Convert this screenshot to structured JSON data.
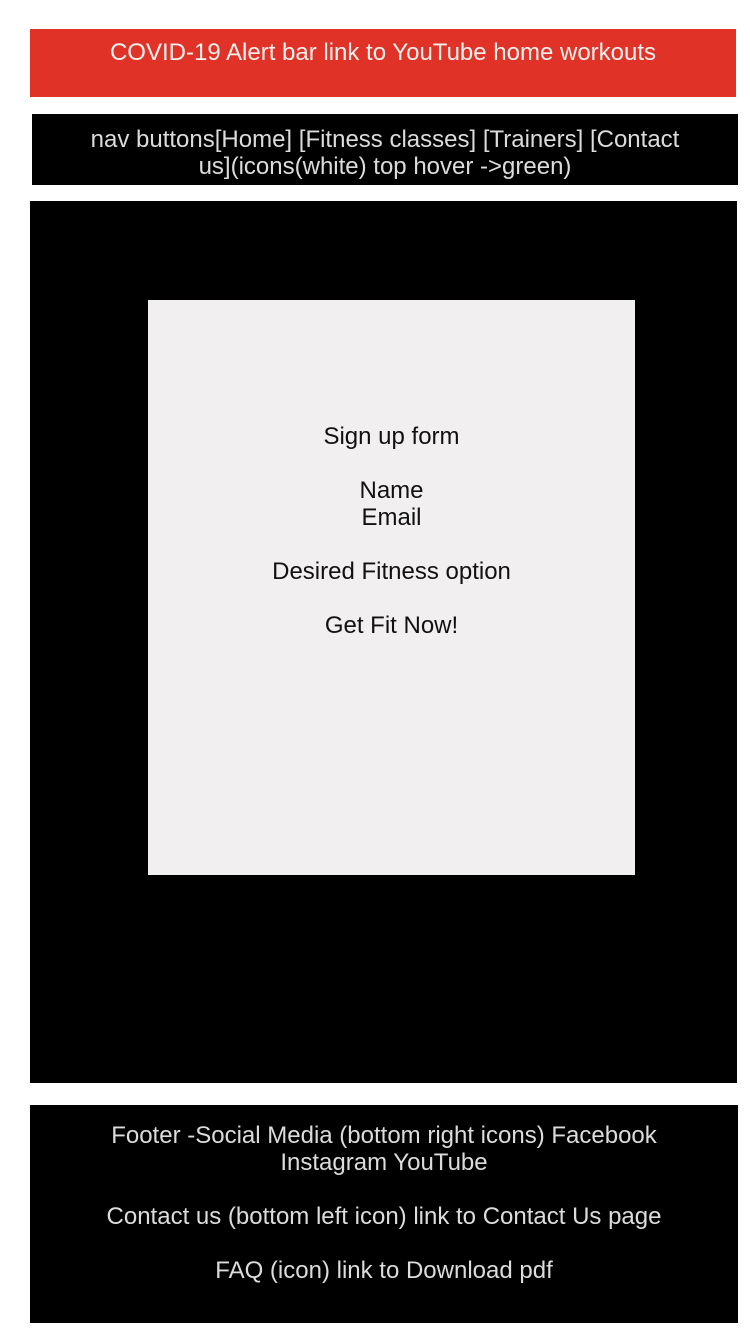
{
  "alert": {
    "text": "COVID-19 Alert bar link to YouTube home workouts"
  },
  "nav": {
    "text": "nav buttons[Home] [Fitness classes] [Trainers] [Contact us](icons(white) top hover ->green)"
  },
  "signup": {
    "title": "Sign up form",
    "name_label": "Name",
    "email_label": "Email",
    "option_label": "Desired Fitness option",
    "cta_label": "Get Fit Now!"
  },
  "footer": {
    "social_text": "Footer -Social Media (bottom right icons) Facebook Instagram YouTube",
    "contact_text": "Contact us (bottom left icon) link to Contact Us page",
    "faq_text": "FAQ (icon) link to Download pdf"
  },
  "colors": {
    "alert_bg": "#e03226",
    "dark_bg": "#000000",
    "card_bg": "#f1eff0"
  }
}
